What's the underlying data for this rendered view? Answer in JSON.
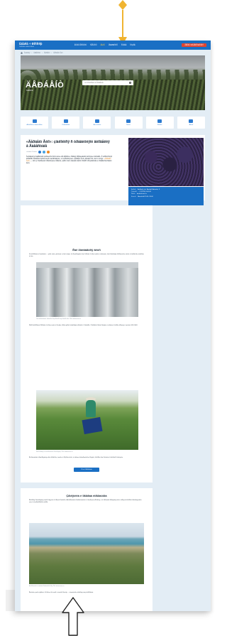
{
  "nav": {
    "logo_title": "Üáàêà ÷ Ðîññèþ",
    "logo_sub": "Òóðèñòè÷åñêèé ïîðòàë",
    "links": [
      "Êóäà ïîåõàòü",
      "Ñîâåòû",
      "Ãèäû",
      "Ìàðøðóòû",
      "Îòåëè",
      "Ìóçåè"
    ],
    "active_index": 2,
    "cta": "Âîéòè / Ðåãèñòðàöèÿ"
  },
  "breadcrumb": [
    "Ãëàâíàÿ",
    "›",
    "Äàãåñòàí",
    "›",
    "Äåðáåíò",
    "›",
    "Äåðáåíò Âèíî"
  ],
  "hero": {
    "title": "ÄÅÐÁÅÍÒ",
    "subtitle": "Äàãåñòàí",
    "search_placeholder": "×òî ïîñìîòðåòü â Äåðáåíòå"
  },
  "tiles": [
    "Äîñòîïðèìå÷àòåëüíîñòè",
    "Ýêñêóðñèè",
    "Ãäå ïîåñòü",
    "Îòåëè",
    "Êàðòà",
    "Âèäåî"
  ],
  "article": {
    "title": "«Äåðáåíò Âèíî»: çíàêîìèìñÿ ñ òðàäèöèÿìè âèíîäåëèÿ â Äàãåñòàíå",
    "meta": "×èòàòü 5 ìèíóò",
    "lead": "Âèíîäåëèå â Äàãåñòàíå çàðîäèëîñü åùå â àíòè÷íûå âðåìåíà è ñåãîäíÿ ïåðåæèâàåò íàñòîÿùèé ðàñöâåò. Â îêðåñòíîñòÿõ äðåâíåãî Äåðáåíòà ðàñêèíóëèñü âèíîãðàäíèêè, à íà ïðåäïðèÿòèè «Äåðáåíò Âèíî» äåëàþò ñîê, âèíî è êîíüÿê.",
    "lead_highlight": "«Äåðáåíò Âèíî»",
    "lead_tail": " — îäíî èç ñòàðåéøèõ ïðåäïðèÿòèé ðåãèîíà, çäåñü ìîæíî óâèäåòü âåñü ïðîöåññ ïðîèçâîäñòâà è ïðîäåãóñòèðîâàòü âèíà.",
    "info": [
      {
        "k": "Àäðåñ:",
        "v": "Äåðáåíò, óë. Ãåéäàð Àëèåâà, 9"
      },
      {
        "k": "Òåëåôîí:",
        "v": "+7 (8724) 0-00-00"
      },
      {
        "k": "Ñàéò:",
        "v": "derbentvino.ru"
      },
      {
        "k": "Ðåæèì:",
        "v": "Åæåäíåâíî 9:00–18:00"
      }
    ]
  },
  "section1": {
    "title": "Êàê ðîæäàåòñÿ âêóñ",
    "p1": "Îò âèíîãðàäà äî áóòûëêè — ýòîò ïóòü çàíèìàåò íå îäèí ìåñÿö. Íà ïðåäïðèÿòèè ìîæíî ïðîéòè ïî âñåì öåõàì è óâèäåòü, êàê ðàáîòàþò ñîâðåìåííûå ëèíèè è ñòàðèííûå äóáîâûå áî÷êè.",
    "cap1": "Öåõ ôåðìåíòàöèè: ñòàëüíûå ðåçåðâóàðû äëÿ ìîëîäîãî âèíà. Ôîòî: derbentvino.ru",
    "p2": "Ñáîð âèíîãðàäà ïðîõîäèò â êîíöå ëåòà è îñåíüþ, êîãäà ÿãîäû íàáèðàþò äîñòàòî÷íî ñàõàðà. Òóðèñòû ìîãóò ïðèíÿòü ó÷àñòèå â ñáîðå óðîæàÿ è óçíàòü ìíîãî íîâîãî.",
    "cap2": "Ñáîð óðîæàÿ íà âèíîãðàäíèêàõ ïðåäïðèÿòèÿ. Ôîòî: derbentvino.ru",
    "p3": "Â êîëëåêöèè ïðåäïðèÿòèÿ åñòü êðàñíûå, áåëûå è ðîçîâûå âèíà, à òàêæå âûäåðæàííûå êîíüÿêè, êîòîðûå ìîæíî êóïèòü â ôèðìåííîì ìàãàçèíå.",
    "button": "Õî÷ó ïîïðîáîâàòü"
  },
  "section2": {
    "title": "Çåìëÿíèêà è ïîãðåáà èìïåðàòîðà",
    "p1": "Èñòîðèÿ ïðåäïðèÿòèÿ òåñíî ñâÿçàíà ñ ïðîøëûì ðåãèîíà. Âèíîãðàäíèêè ðàñêèíóëèñü íà ïîáåðåæüå Êàñïèÿ, à â ïîãðåáàõ õðàíÿòñÿ âèíà, îáðàçöû êîòîðûõ ïîñòàâëÿëèñü åùå ê èìïåðàòîðñêîìó äâîðó.",
    "cap": "Âèíîãðàäíèêè íà áåðåãó Êàñïèéñêîãî ìîðÿ. Ôîòî: derbentvino.ru",
    "p2": "Êëèìàò çäåñü ìÿãêèé, ñî ñîëíå÷íûì ëåòîì è òåïëîé îñåíüþ — èäåàëüíûå óñëîâèÿ äëÿ âèíîãðàäà."
  }
}
